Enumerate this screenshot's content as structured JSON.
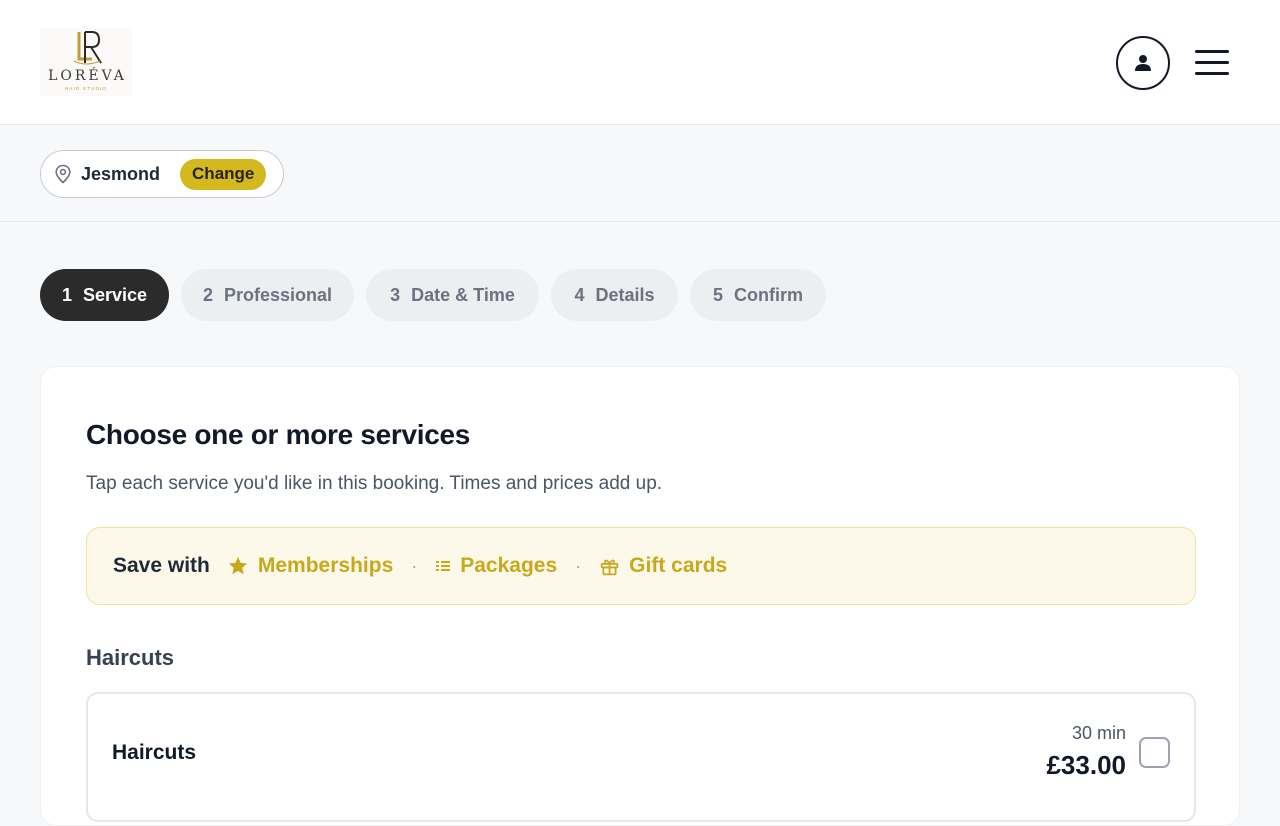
{
  "brand": {
    "name": "LORÉVA",
    "tagline": "HAIR STUDIO",
    "accent": "#d4b81f",
    "gold": "#c39b3a"
  },
  "header": {
    "account_icon": "user-circle-icon",
    "menu_icon": "hamburger-menu-icon"
  },
  "location": {
    "icon": "map-pin-icon",
    "name": "Jesmond",
    "change_label": "Change"
  },
  "steps": [
    {
      "num": "1",
      "label": "Service",
      "active": true
    },
    {
      "num": "2",
      "label": "Professional",
      "active": false
    },
    {
      "num": "3",
      "label": "Date & Time",
      "active": false
    },
    {
      "num": "4",
      "label": "Details",
      "active": false
    },
    {
      "num": "5",
      "label": "Confirm",
      "active": false
    }
  ],
  "main": {
    "title": "Choose one or more services",
    "subtitle": "Tap each service you'd like in this booking. Times and prices add up.",
    "save": {
      "label": "Save with",
      "links": [
        {
          "icon": "star-icon",
          "label": "Memberships"
        },
        {
          "icon": "list-icon",
          "label": "Packages"
        },
        {
          "icon": "gift-icon",
          "label": "Gift cards"
        }
      ],
      "separator": "·"
    },
    "category": "Haircuts",
    "services": [
      {
        "name": "Haircuts",
        "duration": "30 min",
        "price": "£33.00",
        "selected": false
      }
    ]
  }
}
